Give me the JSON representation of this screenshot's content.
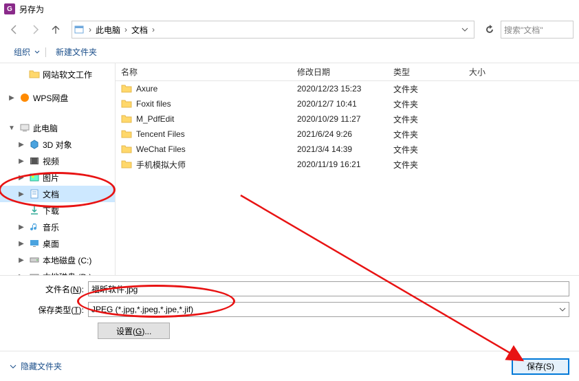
{
  "title": "另存为",
  "breadcrumb": {
    "root": "此电脑",
    "segs": [
      "文档"
    ]
  },
  "search_placeholder": "搜索\"文档\"",
  "toolbar": {
    "organize": "组织",
    "new_folder": "新建文件夹"
  },
  "tree": {
    "items": [
      {
        "label": "网站软文工作",
        "icon": "folder",
        "indent": 2,
        "tw": ""
      },
      {
        "label": "WPS网盘",
        "icon": "wps",
        "indent": 1,
        "tw": "▶"
      },
      {
        "label": "此电脑",
        "icon": "pc",
        "indent": 1,
        "tw": "▼"
      },
      {
        "label": "3D 对象",
        "icon": "3d",
        "indent": 2,
        "tw": "▶"
      },
      {
        "label": "视频",
        "icon": "video",
        "indent": 2,
        "tw": "▶"
      },
      {
        "label": "图片",
        "icon": "pic",
        "indent": 2,
        "tw": "▶"
      },
      {
        "label": "文档",
        "icon": "doc",
        "indent": 2,
        "tw": "▶",
        "sel": true
      },
      {
        "label": "下载",
        "icon": "down",
        "indent": 2,
        "tw": ""
      },
      {
        "label": "音乐",
        "icon": "music",
        "indent": 2,
        "tw": "▶"
      },
      {
        "label": "桌面",
        "icon": "desktop",
        "indent": 2,
        "tw": "▶"
      },
      {
        "label": "本地磁盘 (C:)",
        "icon": "disk",
        "indent": 2,
        "tw": "▶"
      },
      {
        "label": "本地磁盘 (D:)",
        "icon": "disk",
        "indent": 2,
        "tw": "▶"
      }
    ]
  },
  "columns": {
    "name": "名称",
    "date": "修改日期",
    "type": "类型",
    "size": "大小"
  },
  "files": [
    {
      "name": "Axure",
      "date": "2020/12/23 15:23",
      "type": "文件夹"
    },
    {
      "name": "Foxit files",
      "date": "2020/12/7 10:41",
      "type": "文件夹"
    },
    {
      "name": "M_PdfEdit",
      "date": "2020/10/29 11:27",
      "type": "文件夹"
    },
    {
      "name": "Tencent Files",
      "date": "2021/6/24 9:26",
      "type": "文件夹"
    },
    {
      "name": "WeChat Files",
      "date": "2021/3/4 14:39",
      "type": "文件夹"
    },
    {
      "name": "手机模拟大师",
      "date": "2020/11/19 16:21",
      "type": "文件夹"
    }
  ],
  "filename_label": "文件名(",
  "filename_accel": "N",
  "filename_label2": "):",
  "filename_value": "福昕软件.jpg",
  "savetype_label": "保存类型(",
  "savetype_accel": "T",
  "savetype_label2": "):",
  "savetype_value": "JPEG (*.jpg,*.jpeg,*.jpe,*.jif)",
  "settings_label": "设置(",
  "settings_accel": "G",
  "settings_label2": ")...",
  "hide_folders": "隐藏文件夹",
  "save_label": "保存(",
  "save_accel": "S",
  "save_label2": ")"
}
